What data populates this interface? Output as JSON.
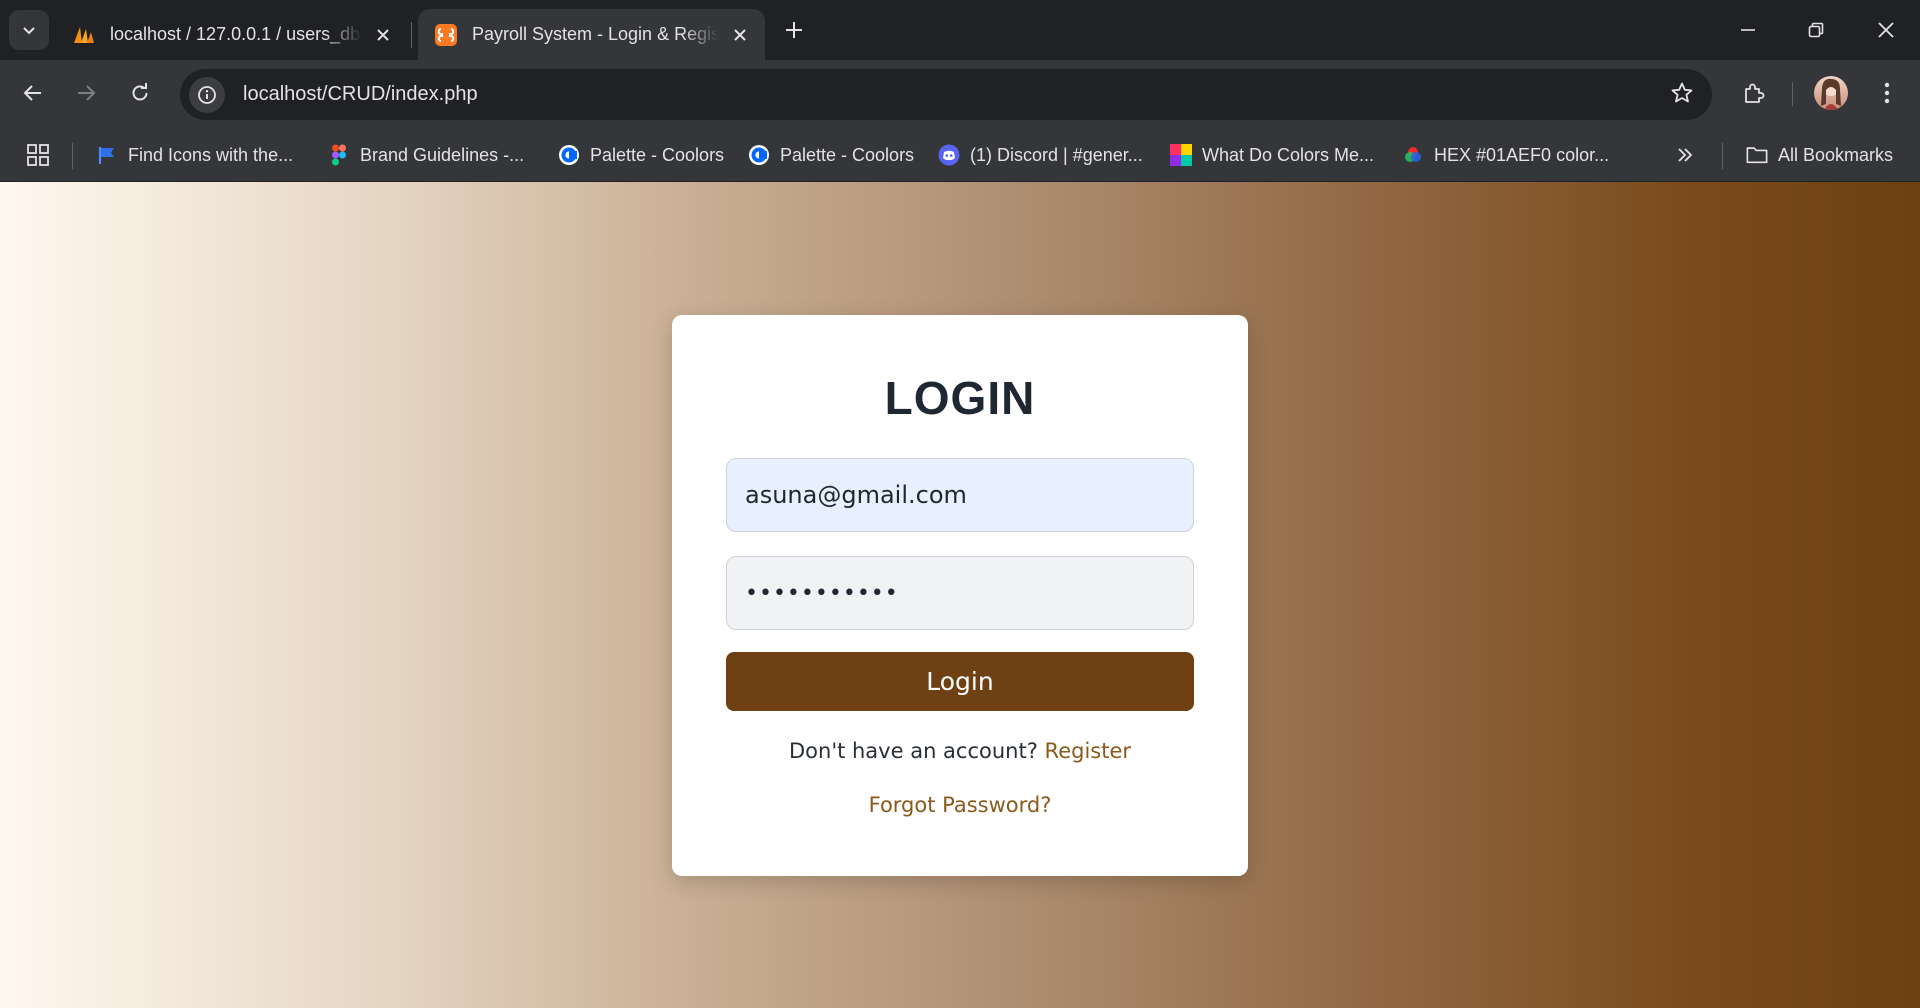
{
  "browser": {
    "tabs": [
      {
        "title": "localhost / 127.0.0.1 / users_db",
        "favicon": "phpmyadmin-icon",
        "active": false
      },
      {
        "title": "Payroll System - Login & Registe",
        "favicon": "xampp-icon",
        "active": true
      }
    ],
    "url": "localhost/CRUD/index.php",
    "bookmarks": [
      {
        "label": "Find Icons with the...",
        "icon": "flag-icon"
      },
      {
        "label": "Brand Guidelines -...",
        "icon": "figma-icon"
      },
      {
        "label": "Palette - Coolors",
        "icon": "coolors-icon"
      },
      {
        "label": "Palette - Coolors",
        "icon": "coolors-icon"
      },
      {
        "label": "(1) Discord | #gener...",
        "icon": "discord-icon"
      },
      {
        "label": "What Do Colors Me...",
        "icon": "colors-icon"
      },
      {
        "label": "HEX #01AEF0 color...",
        "icon": "color-wheel-icon"
      }
    ],
    "all_bookmarks_label": "All Bookmarks"
  },
  "login": {
    "heading": "LOGIN",
    "email_value": "asuna@gmail.com",
    "password_value": "•••••••••••",
    "button_label": "Login",
    "no_account_text": "Don't have an account?",
    "register_link": "Register",
    "forgot_link": "Forgot Password?"
  },
  "colors": {
    "button": "#6e4014",
    "link": "#8a5a1a",
    "gradient_start": "#fff8ef",
    "gradient_end": "#6e4012"
  }
}
